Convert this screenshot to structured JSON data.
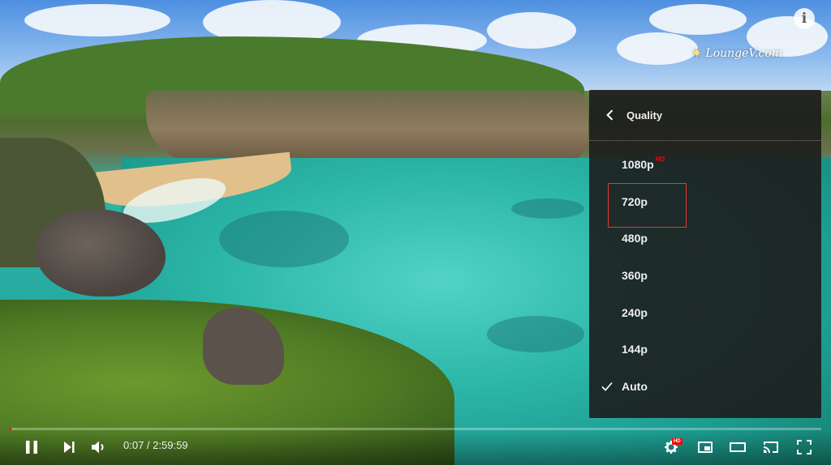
{
  "watermark": {
    "text": "LoungeV.com"
  },
  "info_button": {
    "label": "i"
  },
  "quality_menu": {
    "title": "Quality",
    "options": [
      {
        "label": "1080p",
        "badge": "HD",
        "selected": false
      },
      {
        "label": "720p",
        "badge": "",
        "selected": false
      },
      {
        "label": "480p",
        "badge": "",
        "selected": false
      },
      {
        "label": "360p",
        "badge": "",
        "selected": false
      },
      {
        "label": "240p",
        "badge": "",
        "selected": false
      },
      {
        "label": "144p",
        "badge": "",
        "selected": false
      },
      {
        "label": "Auto",
        "badge": "",
        "selected": true
      }
    ]
  },
  "player": {
    "current_time": "0:07",
    "duration": "2:59:59",
    "time_separator": " / ",
    "progress_fraction": 0.001,
    "settings_badge": "HD",
    "accent_color": "#ff0000"
  },
  "icons": {
    "pause": "pause-icon",
    "next": "next-icon",
    "volume": "volume-icon",
    "settings": "gear-icon",
    "miniplayer": "miniplayer-icon",
    "theater": "theater-icon",
    "cast": "cast-icon",
    "fullscreen": "fullscreen-icon"
  }
}
